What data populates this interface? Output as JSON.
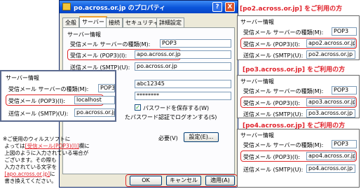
{
  "dialog": {
    "title": "po.across.or.jp のプロパティ",
    "help_symbol": "?",
    "close_symbol": "X",
    "tabs": [
      "全般",
      "サーバー",
      "接続",
      "セキュリティ",
      "詳細設定"
    ],
    "section_title": "サーバー情報",
    "rows": {
      "server_type_label": "受信メール サーバーの種類(M):",
      "server_type_value": "POP3",
      "incoming_label": "受信メール (POP3)(I):",
      "incoming_value": "apo.across.or.jp",
      "outgoing_label": "送信メール (SMTP)(U):",
      "outgoing_value": "po.across.or.jp"
    },
    "account_value": "abc12345",
    "password_value": "********",
    "remember_password_label": "パスワードを保存する(W)",
    "spa_label": "たパスワード認証でログオンする(S)",
    "auth_required_text": "必要(V)",
    "settings_button": "設定(E)...",
    "buttons": {
      "ok": "OK",
      "cancel": "キャンセル",
      "apply": "適用(A)"
    }
  },
  "left_popup": {
    "section_title": "サーバー情報",
    "server_type_label": "受信メール サーバーの種類(M):",
    "server_type_value": "POP3",
    "incoming_label": "受信メール (POP3)(I):",
    "incoming_value": "localhost",
    "outgoing_label": "送信メール (SMTP)(U):",
    "outgoing_value": "po.across.or.jp"
  },
  "note": {
    "line1": "※ご使用のウィルスソフトに",
    "line2a": "よっては",
    "line2_red": "[受信メール(POP3)(I)]",
    "line2b": "欄に",
    "line3": "上図のように入力されている場合が",
    "line4": "ございます。その際も",
    "line5": "入力されている文字を",
    "line6_red": "[apo.across.or.jp]",
    "line6b": "に",
    "line7": "書き換えてください。"
  },
  "right_cards": [
    {
      "heading": "[po2.across.or.jp] をご利用の方",
      "section_title": "サーバー情報",
      "server_type_label": "受信メール サーバーの種類(M):",
      "server_type_value": "POP3",
      "incoming_label": "受信メール (POP3)(I):",
      "incoming_value": "apo2.across.or.jp",
      "outgoing_label": "送信メール (SMTP)(U):",
      "outgoing_value": "po2.across.or.jp"
    },
    {
      "heading": "[po3.across.or.jp] をご利用の方",
      "section_title": "サーバー情報",
      "server_type_label": "受信メール サーバーの種類(M):",
      "server_type_value": "POP3",
      "incoming_label": "受信メール (POP3)(I):",
      "incoming_value": "apo3.across.or.jp",
      "outgoing_label": "送信メール (SMTP)(U):",
      "outgoing_value": "po3.across.or.jp"
    },
    {
      "heading": "[po4.across.or.jp] をご利用の方",
      "section_title": "サーバー情報",
      "server_type_label": "受信メール サーバーの種類(M):",
      "server_type_value": "POP3",
      "incoming_label": "受信メール (POP3)(I):",
      "incoming_value": "apo4.across.or.jp",
      "outgoing_label": "送信メール (SMTP)(U):",
      "outgoing_value": "po4.across.or.jp"
    }
  ],
  "colors": {
    "highlight": "#e0222b",
    "titlebar": "#0a54d9",
    "dialog_bg": "#ece9d8"
  }
}
